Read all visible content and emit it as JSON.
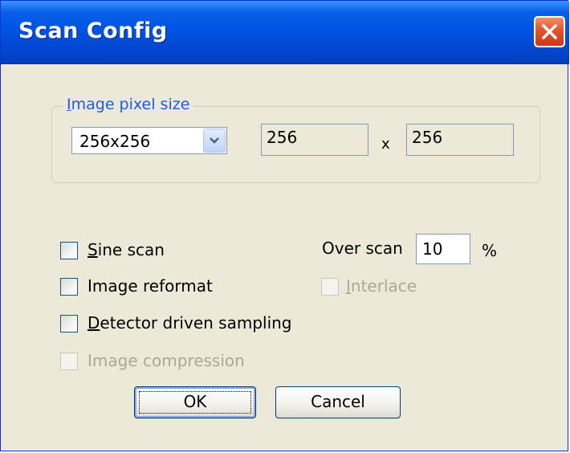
{
  "window": {
    "title": "Scan Config",
    "close_icon": "close-icon"
  },
  "pixel_size_group": {
    "label_prefix": "",
    "label_hotkey": "I",
    "label_rest": "mage pixel size",
    "preset_selected": "256x256",
    "width_value": "256",
    "times_symbol": "x",
    "height_value": "256"
  },
  "options": {
    "sine_scan": {
      "hotkey": "S",
      "rest": "ine scan",
      "checked": false,
      "enabled": true
    },
    "image_reformat": {
      "label": "Image reformat",
      "checked": false,
      "enabled": true
    },
    "detector_driven": {
      "hotkey": "D",
      "rest": "etector driven sampling",
      "checked": false,
      "enabled": true
    },
    "image_compression": {
      "label": "Image compression",
      "checked": false,
      "enabled": false
    },
    "interlace": {
      "hotkey": "I",
      "rest": "nterlace",
      "checked": false,
      "enabled": false
    }
  },
  "over_scan": {
    "label": "Over scan",
    "value": "10",
    "unit": "%"
  },
  "buttons": {
    "ok": "OK",
    "cancel": "Cancel"
  },
  "colors": {
    "title_bar": "#0054E3",
    "dialog_face": "#ECE9D8",
    "group_label": "#1D5BE0",
    "close_button": "#E2542C",
    "disabled_text": "#ACA899"
  }
}
